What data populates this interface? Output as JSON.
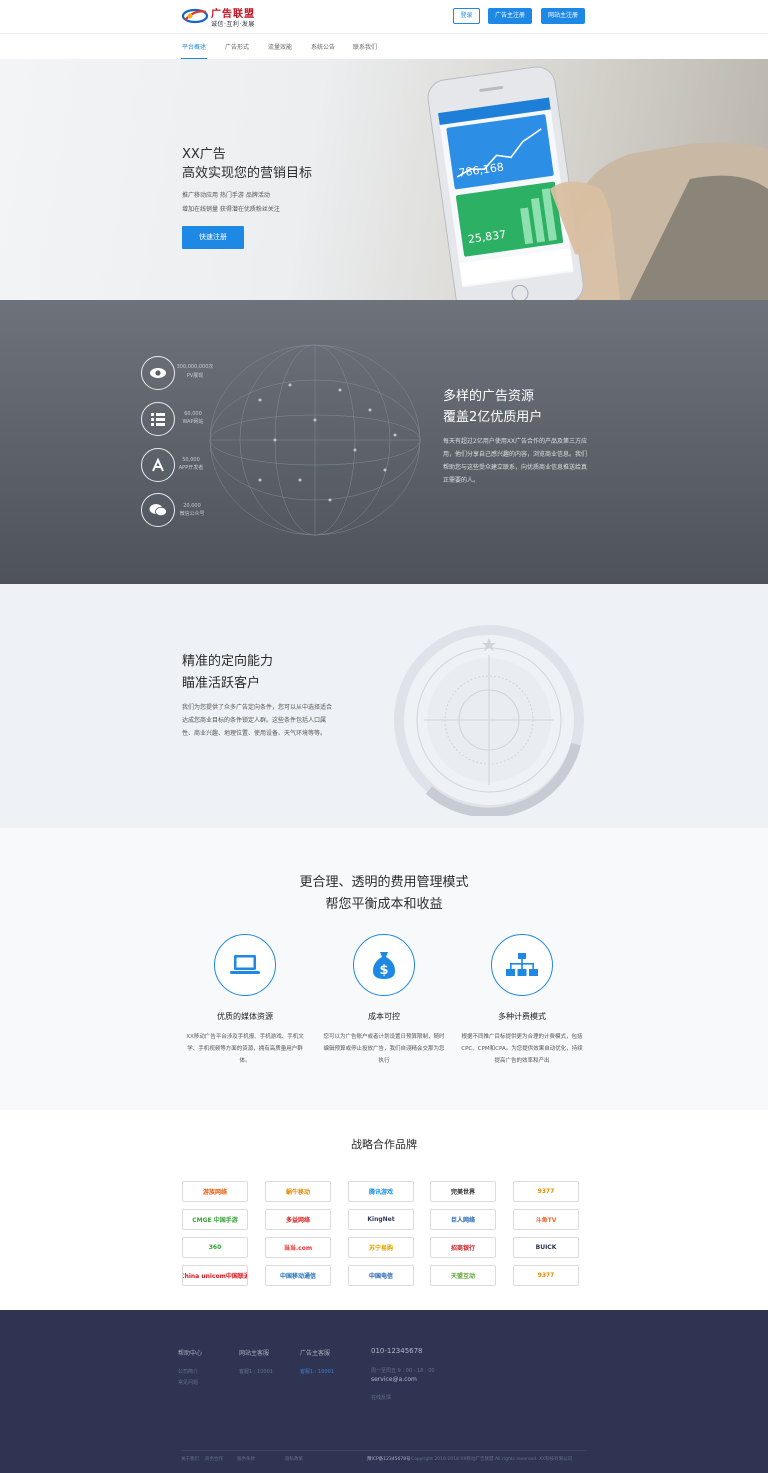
{
  "header": {
    "logo_title": "广告联盟",
    "logo_slogan": "诚信·互利·发展",
    "btn_login": "登录",
    "btn_advertiser_register": "广告主注册",
    "btn_publisher_register": "网站主注册"
  },
  "nav": {
    "items": [
      "平台概述",
      "广告形式",
      "流量效能",
      "系统公告",
      "联系我们"
    ],
    "active": "平台概述"
  },
  "hero": {
    "title1": "XX广告",
    "title2": "高效实现您的营销目标",
    "sub1": "推广移动应用 热门手游 品牌活动",
    "sub2": "增加在线销量 获得潜在优质粉丝关注",
    "btn": "快速注册",
    "phone_num1": "786,168",
    "phone_num2": "25,837"
  },
  "resources": {
    "stats": [
      {
        "icon": "eye-icon",
        "value": "300,000,000次",
        "label": "PV展现"
      },
      {
        "icon": "list-icon",
        "value": "60,000",
        "label": "WAP网站"
      },
      {
        "icon": "app-store-icon",
        "value": "50,000",
        "label": "APP开发者"
      },
      {
        "icon": "chat-icon",
        "value": "20,000",
        "label": "微信公众号"
      }
    ],
    "title1": "多样的广告资源",
    "title2": "覆盖2亿优质用户",
    "desc": "每天有超过2亿用户使用XX广告合作的产品及第三方应用，他们分享自己感兴趣的内容，浏览商业信息。我们帮助您与这些受众建立联系，向优质商业信息推送给真正需要的人。"
  },
  "targeting": {
    "title1": "精准的定向能力",
    "title2": "瞄准活跃客户",
    "desc": "我们为您提供了众多广告定向条件，您可以从中选择适合达成您商业目标的条件锁定人群。这些条件包括人口属性、商业兴趣、地理位置、使用设备、天气环境等等。"
  },
  "fee": {
    "title1": "更合理、透明的费用管理模式",
    "title2": "帮您平衡成本和收益",
    "items": [
      {
        "icon": "laptop-icon",
        "title": "优质的媒体资源",
        "desc": "XX移动广告平台涉及手机报、手机游戏、手机文学、手机视频等方面的资源，拥有高质量用户群体。"
      },
      {
        "icon": "money-bag-icon",
        "title": "成本可控",
        "desc": "您可以为广告账户或者计划设置日预算限制，随时编辑预算或停止投放广告，我们自诩精会交那为您执行"
      },
      {
        "icon": "hierarchy-icon",
        "title": "多种计费模式",
        "desc": "根据不同推广目标提供更为合理的计费模式，包括CPC、CPM和CPA。为您提供效果自动优化，持续提高广告的效率和产出"
      }
    ]
  },
  "brands": {
    "title": "战略合作品牌",
    "items": [
      {
        "name": "游族网络",
        "color": "#e95c10"
      },
      {
        "name": "蜗牛移动",
        "color": "#e28a00"
      },
      {
        "name": "腾讯游戏",
        "color": "#1f8ee0"
      },
      {
        "name": "完美世界",
        "color": "#222222"
      },
      {
        "name": "9377",
        "color": "#e68a00"
      },
      {
        "name": "CMGE 中国手游",
        "color": "#3aa23c"
      },
      {
        "name": "多益网络",
        "color": "#d8231e"
      },
      {
        "name": "KingNet",
        "color": "#2d3a55"
      },
      {
        "name": "巨人网络",
        "color": "#1e62b6"
      },
      {
        "name": "斗鱼TV",
        "color": "#f0642a"
      },
      {
        "name": "360",
        "color": "#2ea333"
      },
      {
        "name": "当当.com",
        "color": "#e8302b"
      },
      {
        "name": "苏宁易购",
        "color": "#e6a300"
      },
      {
        "name": "招商银行",
        "color": "#c81d25"
      },
      {
        "name": "BUICK",
        "color": "#2a3348"
      },
      {
        "name": "China unicom中国联通",
        "color": "#d8161d"
      },
      {
        "name": "中国移动通信",
        "color": "#1e6fba"
      },
      {
        "name": "中国电信",
        "color": "#1f5fb0"
      },
      {
        "name": "天盟互动",
        "color": "#5ba832"
      },
      {
        "name": "9377",
        "color": "#e68a00"
      }
    ]
  },
  "footer": {
    "col1_title": "帮助中心",
    "col1_links": [
      "公司简介",
      "常见问题"
    ],
    "col2_title": "网站主客服",
    "col2_links": [
      "客服1 : 10001"
    ],
    "col3_title": "广告主客服",
    "col3_links": [
      "客服1 : 10001"
    ],
    "phone": "010-12345678",
    "hours": "周一至周五 9 : 00 - 18 : 00",
    "email": "service@a.com",
    "feedback": "在线反馈",
    "bottom_links": [
      "关于我们",
      "商务合作",
      "服务条款",
      "隐私政策"
    ],
    "icp": "豫ICP备12345678号",
    "copyright": "Copyright 2016-2018 XX移动广告联盟 All rights reserved. XX科技有限公司"
  }
}
